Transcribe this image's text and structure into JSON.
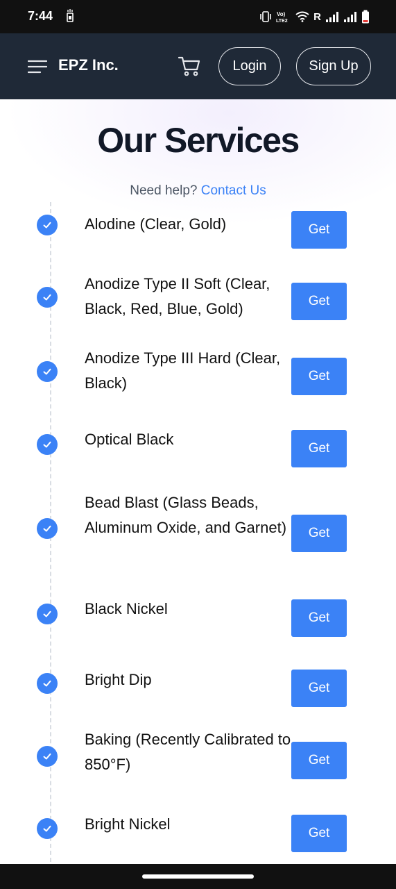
{
  "status_bar": {
    "time": "7:44",
    "network_label": "Vo) LTE2",
    "roaming": "R",
    "icons": [
      "sim-icon",
      "vibrate-icon",
      "volte-icon",
      "wifi-icon",
      "signal-icon",
      "battery-icon"
    ]
  },
  "header": {
    "menu_icon": "hamburger-menu-icon",
    "brand": "EPZ Inc.",
    "cart_icon": "cart-icon",
    "login_label": "Login",
    "signup_label": "Sign Up",
    "background_color": "#1f2937"
  },
  "main": {
    "title": "Our Services",
    "help_text": "Need help?",
    "contact_link": "Contact Us",
    "accent_color": "#3b82f6",
    "services": [
      {
        "name": "Alodine (Clear, Gold)",
        "button": "Get"
      },
      {
        "name": "Anodize Type II Soft (Clear, Black, Red, Blue, Gold)",
        "button": "Get"
      },
      {
        "name": "Anodize Type III Hard (Clear, Black)",
        "button": "Get"
      },
      {
        "name": "Optical Black",
        "button": "Get"
      },
      {
        "name": "Bead Blast (Glass Beads, Aluminum Oxide, and Garnet)",
        "button": "Get"
      },
      {
        "name": "Black Nickel",
        "button": "Get"
      },
      {
        "name": "Bright Dip",
        "button": "Get"
      },
      {
        "name": "Baking (Recently Calibrated to 850°F)",
        "button": "Get"
      },
      {
        "name": "Bright Nickel",
        "button": "Get"
      }
    ]
  },
  "nav_bar": {
    "home_indicator": "home-indicator"
  }
}
